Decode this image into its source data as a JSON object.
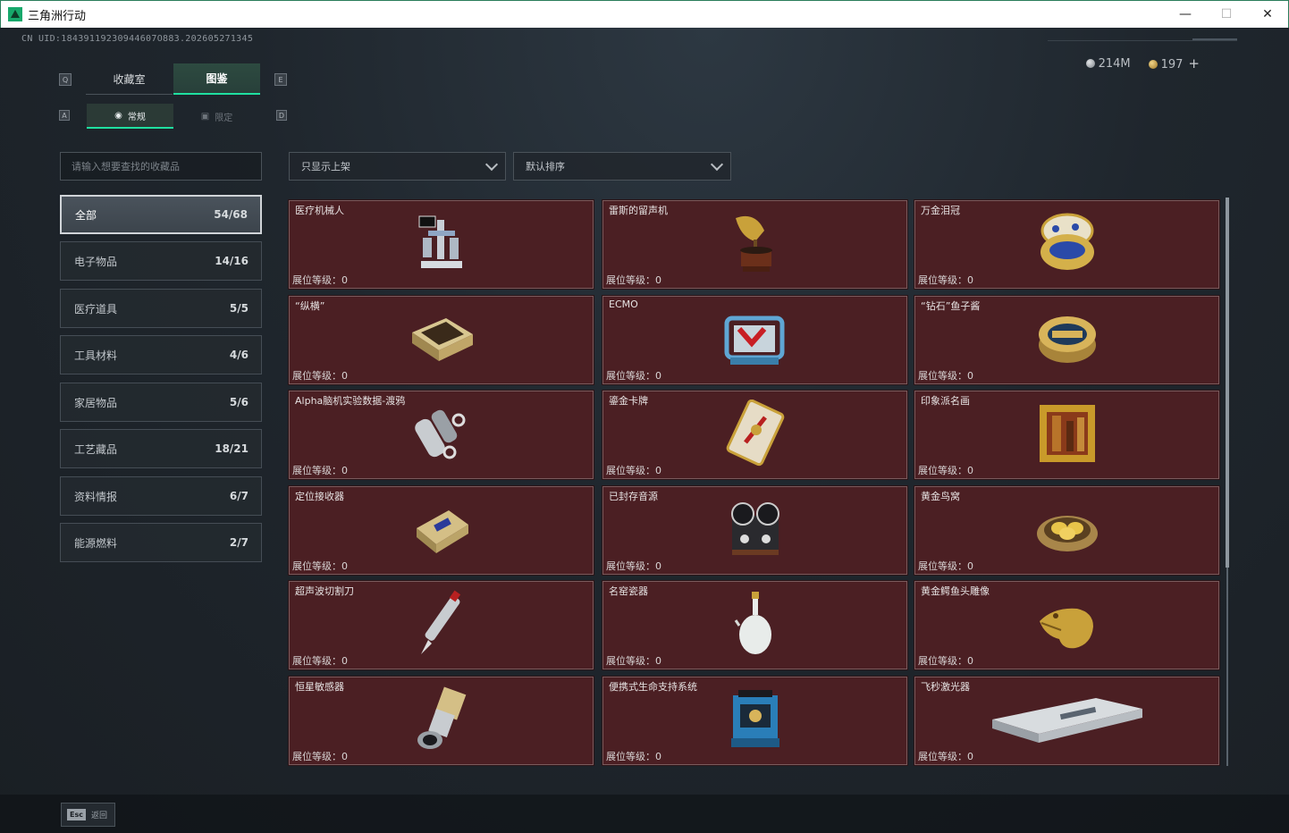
{
  "window": {
    "title": "三角洲行动",
    "minimize": "—",
    "maximize": "☐",
    "close": "✕"
  },
  "uid": "CN UID:18439119230944607O883.202605271345",
  "currency": {
    "silver": "214M",
    "gold": "197",
    "plus": "+"
  },
  "keys": {
    "left_tab": "Q",
    "right_tab": "E",
    "left_sub": "A",
    "right_sub": "D"
  },
  "tabs": [
    {
      "label": "收藏室",
      "active": false
    },
    {
      "label": "图鉴",
      "active": true
    }
  ],
  "subtabs": [
    {
      "label": "常规",
      "icon": "flame-icon",
      "active": true
    },
    {
      "label": "限定",
      "icon": "image-icon",
      "active": false
    }
  ],
  "search": {
    "placeholder": "请输入想要查找的收藏品"
  },
  "filters": {
    "shelf": "只显示上架",
    "sort": "默认排序"
  },
  "categories": [
    {
      "label": "全部",
      "count": "54/68",
      "active": true
    },
    {
      "label": "电子物品",
      "count": "14/16"
    },
    {
      "label": "医疗道具",
      "count": "5/5"
    },
    {
      "label": "工具材料",
      "count": "4/6"
    },
    {
      "label": "家居物品",
      "count": "5/6"
    },
    {
      "label": "工艺藏品",
      "count": "18/21"
    },
    {
      "label": "资料情报",
      "count": "6/7"
    },
    {
      "label": "能源燃料",
      "count": "2/7"
    }
  ],
  "level_prefix": "展位等级：",
  "items": [
    {
      "name": "医疗机械人",
      "level": "0",
      "icon": "medical-robot-icon"
    },
    {
      "name": "雷斯的留声机",
      "level": "0",
      "icon": "gramophone-icon"
    },
    {
      "name": "万金泪冠",
      "level": "0",
      "icon": "jeweled-egg-icon"
    },
    {
      "name": "“纵横”",
      "level": "0",
      "icon": "chess-box-icon"
    },
    {
      "name": "ECMO",
      "level": "0",
      "icon": "ecmo-machine-icon"
    },
    {
      "name": "“钻石”鱼子酱",
      "level": "0",
      "icon": "caviar-tin-icon"
    },
    {
      "name": "Alpha脑机实验数据-渡鸦",
      "level": "0",
      "icon": "data-drive-icon"
    },
    {
      "name": "鎏金卡牌",
      "level": "0",
      "icon": "gilded-card-icon"
    },
    {
      "name": "印象派名画",
      "level": "0",
      "icon": "framed-painting-icon"
    },
    {
      "name": "定位接收器",
      "level": "0",
      "icon": "receiver-icon"
    },
    {
      "name": "已封存音源",
      "level": "0",
      "icon": "reel-recorder-icon"
    },
    {
      "name": "黄金鸟窝",
      "level": "0",
      "icon": "golden-nest-icon"
    },
    {
      "name": "超声波切割刀",
      "level": "0",
      "icon": "ultrasonic-knife-icon"
    },
    {
      "name": "名窑瓷器",
      "level": "0",
      "icon": "porcelain-vase-icon"
    },
    {
      "name": "黄金鳄鱼头雕像",
      "level": "0",
      "icon": "gold-crocodile-icon"
    },
    {
      "name": "恒星敏感器",
      "level": "0",
      "icon": "star-sensor-icon"
    },
    {
      "name": "便携式生命支持系统",
      "level": "0",
      "icon": "life-support-icon"
    },
    {
      "name": "飞秒激光器",
      "level": "0",
      "icon": "femtosecond-laser-icon"
    }
  ],
  "footer": {
    "esc_key": "Esc",
    "esc_label": "返回"
  },
  "colors": {
    "accent": "#1fe0a0",
    "card_bg": "#4b1f23"
  }
}
